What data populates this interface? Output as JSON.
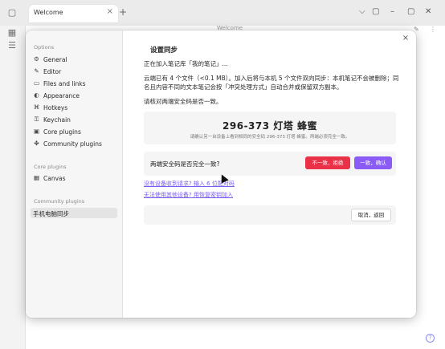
{
  "app": {
    "tab_label": "Welcome",
    "tab_close": "×",
    "new_tab": "+",
    "window_title": "Welcome",
    "win_controls": [
      "⌵",
      "▢",
      "–",
      "▢",
      "✕"
    ]
  },
  "modal": {
    "close": "×",
    "sidebar": {
      "options_title": "Options",
      "options": [
        {
          "label": "General",
          "icon": "gear-icon",
          "glyph": "⚙"
        },
        {
          "label": "Editor",
          "icon": "pencil-icon",
          "glyph": "✎"
        },
        {
          "label": "Files and links",
          "icon": "folder-icon",
          "glyph": "▭"
        },
        {
          "label": "Appearance",
          "icon": "palette-icon",
          "glyph": "◐"
        },
        {
          "label": "Hotkeys",
          "icon": "command-icon",
          "glyph": "⌘"
        },
        {
          "label": "Keychain",
          "icon": "key-icon",
          "glyph": "⚿"
        },
        {
          "label": "Core plugins",
          "icon": "box-icon",
          "glyph": "▣"
        },
        {
          "label": "Community plugins",
          "icon": "puzzle-icon",
          "glyph": "✤"
        }
      ],
      "core_title": "Core plugins",
      "core": [
        {
          "label": "Canvas",
          "icon": "grid-icon",
          "glyph": "▦"
        }
      ],
      "community_title": "Community plugins",
      "community": [
        {
          "label": "手机电脑同步",
          "active": true
        }
      ]
    },
    "content": {
      "title": "设置同步",
      "para1": "正在加入笔记库「我的笔记」...",
      "para2": "云端已有 4 个文件（<0.1 MB）。加入后将与本机 5 个文件双向同步：本机笔记不会被删除；同名且内容不同的文本笔记会按「冲突处理方式」自动合并或保留双方副本。",
      "para3": "请核对两端安全码是否一致。",
      "code": "296-373 灯塔 蜂蜜",
      "code_hint": "请确认另一台设备上看到相同的安全码 296-373 灯塔 蜂蜜。两端必须完全一致。",
      "confirm_question": "两端安全码是否完全一致?",
      "reject_label": "不一致，拒绝",
      "accept_label": "一致，确认",
      "link1": "没有设备收到请求? 输入 6 位配对码",
      "link2": "无法使用其他设备? 用恢复密钥加入",
      "cancel_label": "取消，返回"
    }
  },
  "colors": {
    "accent": "#8a5cf5",
    "danger": "#e93147",
    "link": "#7a5cf0"
  }
}
